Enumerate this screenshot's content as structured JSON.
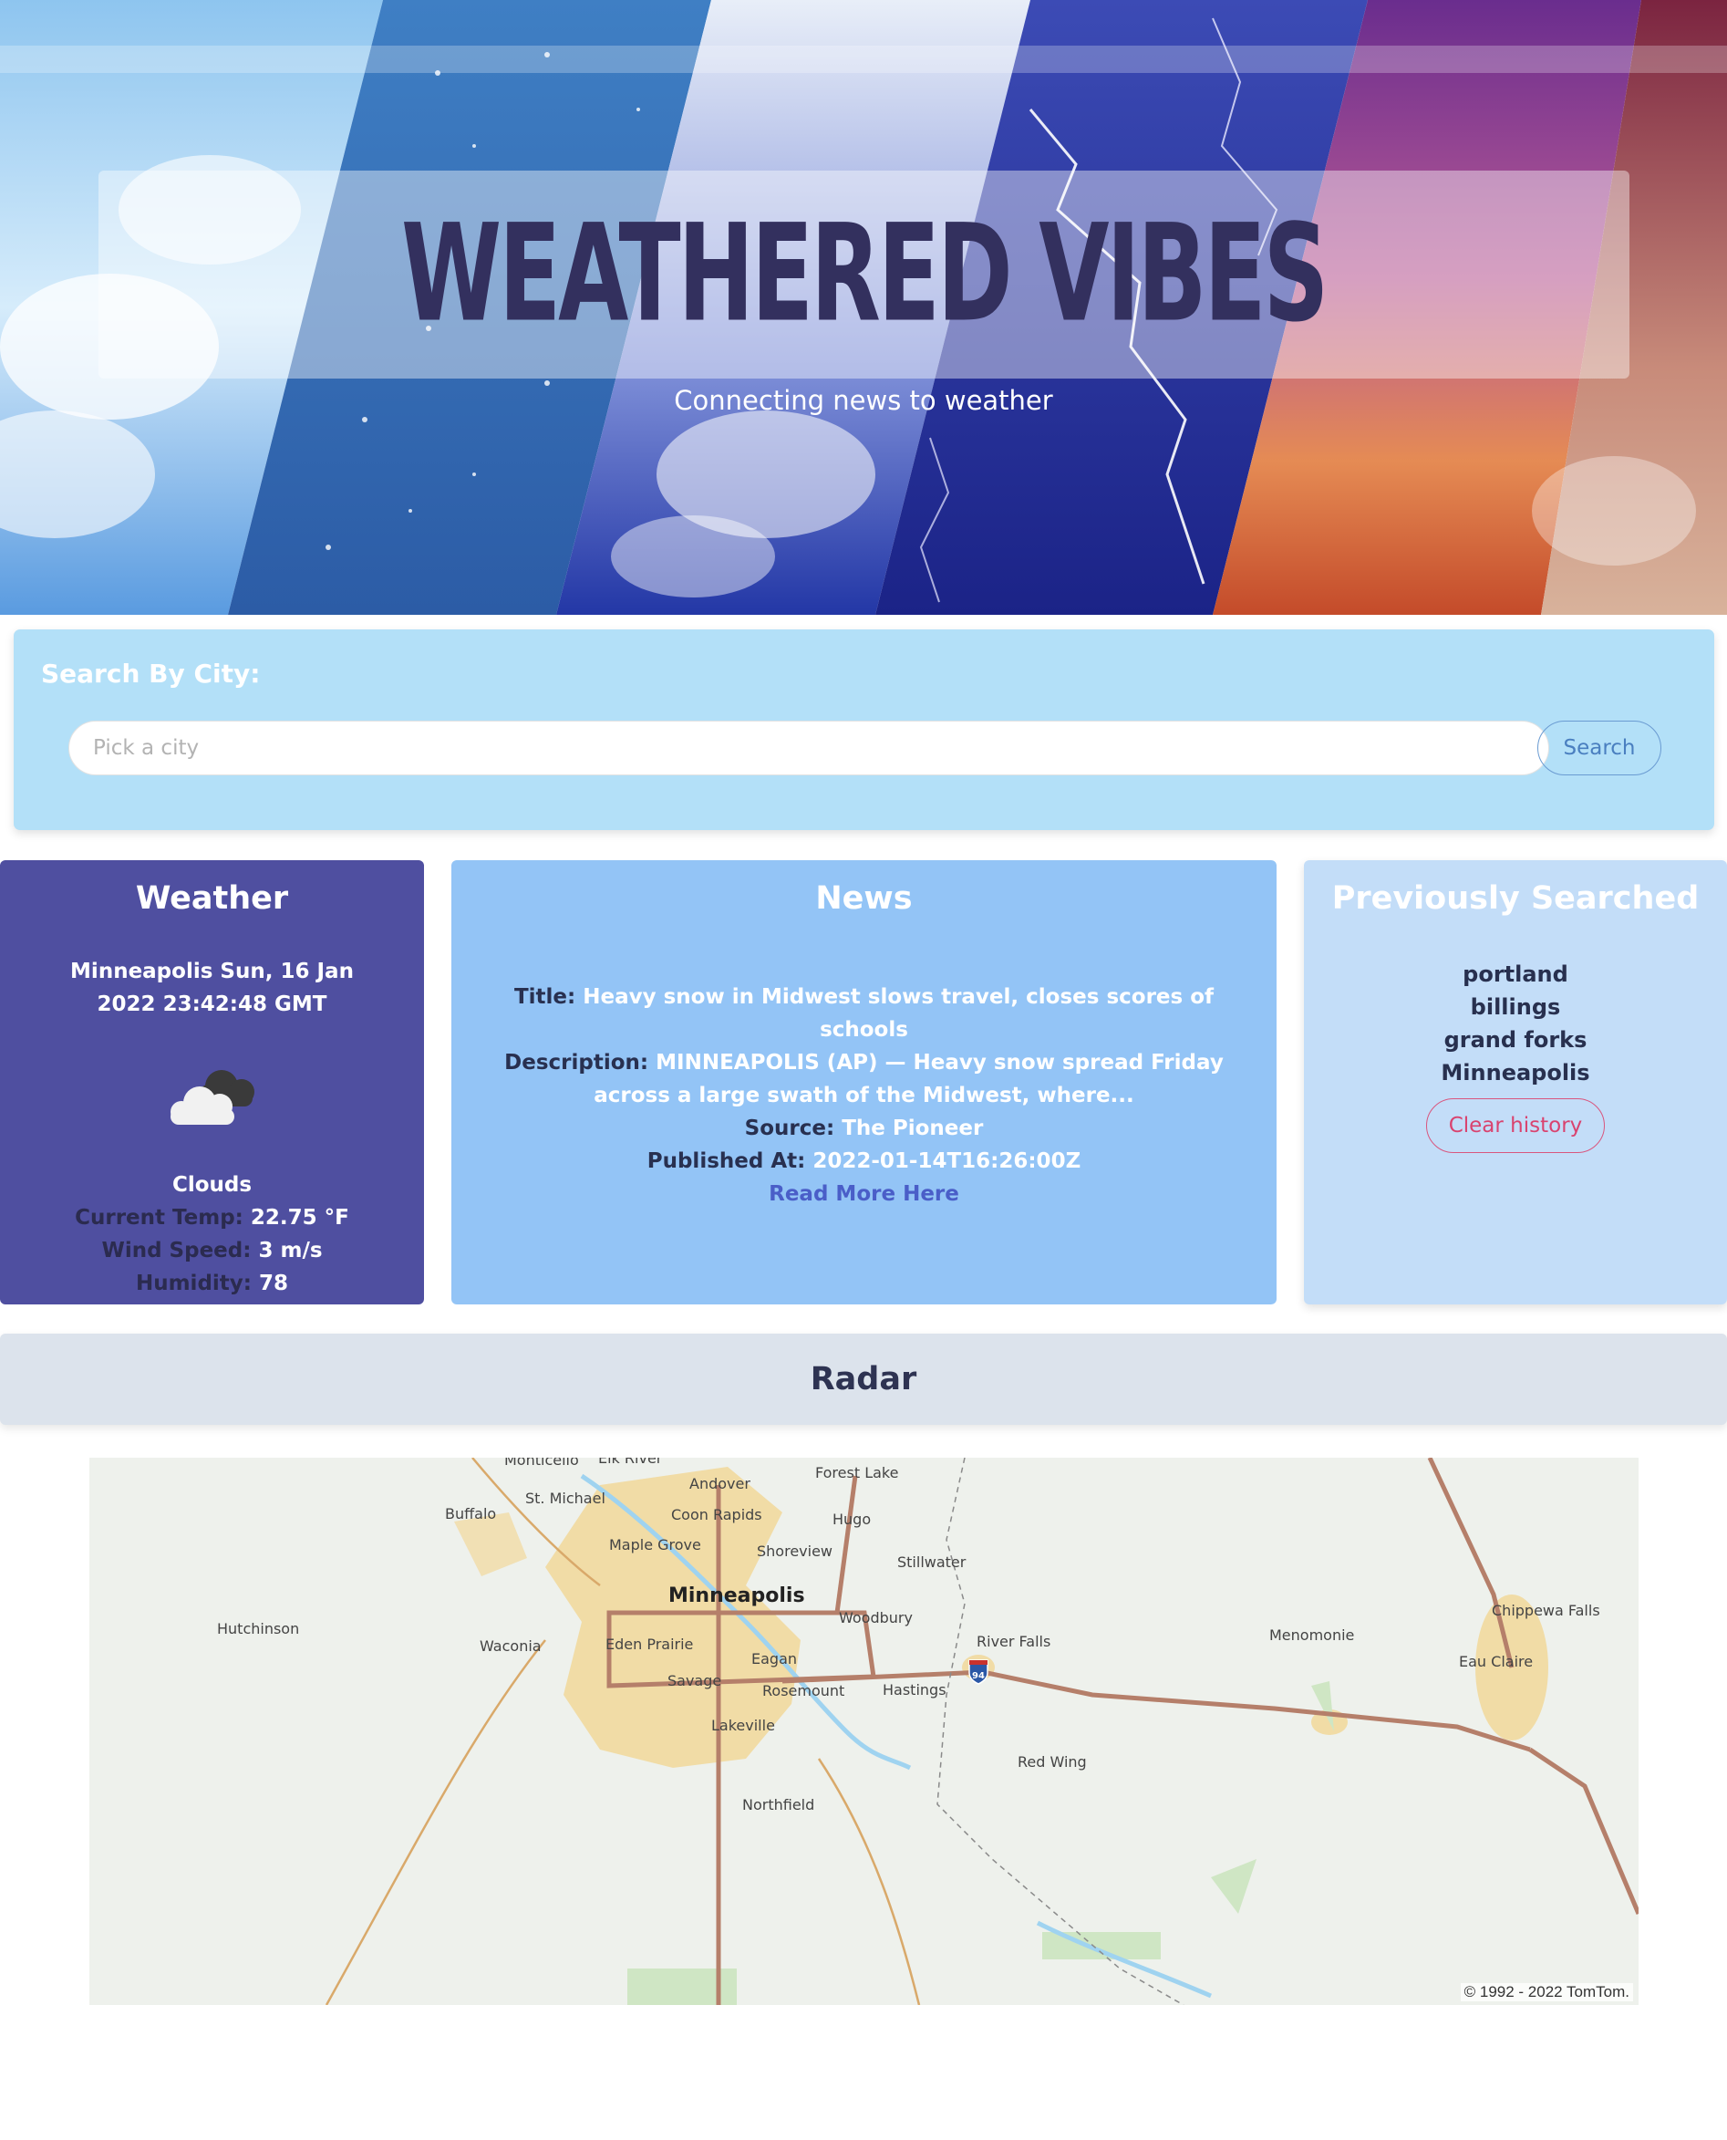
{
  "header": {
    "title": "WEATHERED VIBES",
    "subtitle": "Connecting news to weather"
  },
  "search": {
    "heading": "Search By City:",
    "placeholder": "Pick a city",
    "value": "",
    "button_label": "Search"
  },
  "weather": {
    "title": "Weather",
    "city_date": "Minneapolis Sun, 16 Jan 2022 23:42:48 GMT",
    "icon": "clouds-icon",
    "condition": "Clouds",
    "temp_label": "Current Temp:",
    "temp_value": "22.75 °F",
    "wind_label": "Wind Speed:",
    "wind_value": "3 m/s",
    "humidity_label": "Humidity:",
    "humidity_value": "78"
  },
  "news": {
    "title": "News",
    "title_label": "Title:",
    "title_value": "Heavy snow in Midwest slows travel, closes scores of schools",
    "description_label": "Description:",
    "description_value": "MINNEAPOLIS (AP) — Heavy snow spread Friday across a large swath of the Midwest, where...",
    "source_label": "Source:",
    "source_value": "The Pioneer",
    "published_label": "Published At:",
    "published_value": "2022-01-14T16:26:00Z",
    "link_label": "Read More Here"
  },
  "history": {
    "title": "Previously Searched",
    "items": [
      "portland",
      "billings",
      "grand forks",
      "Minneapolis"
    ],
    "clear_label": "Clear history"
  },
  "radar": {
    "title": "Radar",
    "attribution": "© 1992 - 2022 TomTom.",
    "places": [
      "Monticello",
      "Elk River",
      "Andover",
      "Forest Lake",
      "St. Michael",
      "Buffalo",
      "Coon Rapids",
      "Hugo",
      "Maple Grove",
      "Shoreview",
      "Stillwater",
      "Minneapolis",
      "Woodbury",
      "Hutchinson",
      "Waconia",
      "Eden Prairie",
      "Eagan",
      "River Falls",
      "Menomonie",
      "Chippewa Falls",
      "Eau Claire",
      "Savage",
      "Rosemount",
      "Hastings",
      "Lakeville",
      "Red Wing",
      "Northfield"
    ],
    "highway_shield": "94"
  },
  "colors": {
    "title_ink": "#33305e",
    "search_card": "#b3e0f8",
    "weather_card": "#4f4fa0",
    "news_card": "#93c4f6",
    "history_card": "#c3ddf8",
    "radar_bar": "#dce3ec",
    "clear_button": "#d9436f"
  }
}
